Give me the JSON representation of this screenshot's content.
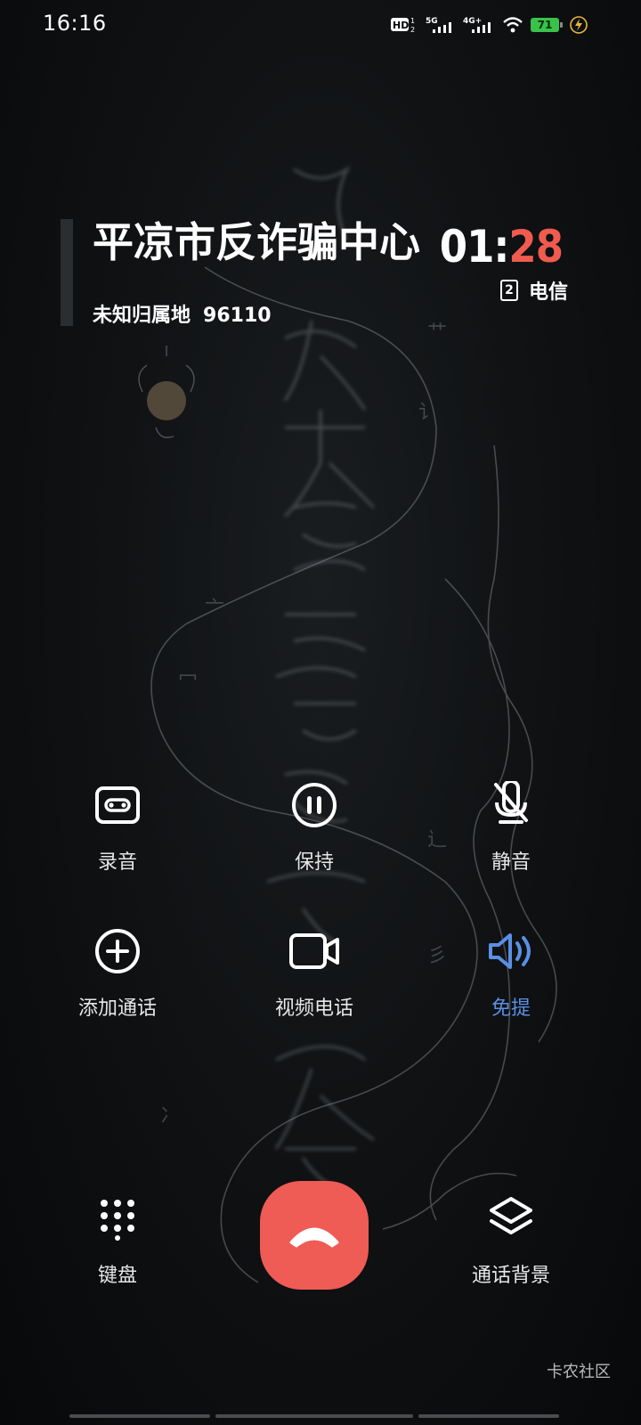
{
  "status_bar": {
    "time": "16:16",
    "hd_label": "HD",
    "net_5g": "5G",
    "net_4g": "4G+",
    "battery_level": "71",
    "icons": [
      "hd-voice-icon",
      "signal-5g-icon",
      "signal-4g-icon",
      "wifi-icon",
      "battery-icon",
      "charging-icon"
    ]
  },
  "caller": {
    "name": "平凉市反诈骗中心",
    "location": "未知归属地",
    "number": "96110"
  },
  "call": {
    "timer_minutes": "01",
    "timer_separator": ":",
    "timer_seconds": "28",
    "sim_slot": "2",
    "carrier": "电信"
  },
  "controls": [
    {
      "label": "录音",
      "icon": "record-tape-icon",
      "active": false
    },
    {
      "label": "保持",
      "icon": "pause-icon",
      "active": false
    },
    {
      "label": "静音",
      "icon": "mute-mic-icon",
      "active": false
    },
    {
      "label": "添加通话",
      "icon": "add-call-icon",
      "active": false
    },
    {
      "label": "视频电话",
      "icon": "video-camera-icon",
      "active": false
    },
    {
      "label": "免提",
      "icon": "speaker-icon",
      "active": true
    }
  ],
  "bottom": {
    "keypad_label": "键盘",
    "background_label": "通话背景"
  },
  "watermark": "卡农社区",
  "colors": {
    "accent_red": "#ef5b55",
    "active_blue": "#5b8fe6",
    "battery_green": "#3ac24a"
  }
}
